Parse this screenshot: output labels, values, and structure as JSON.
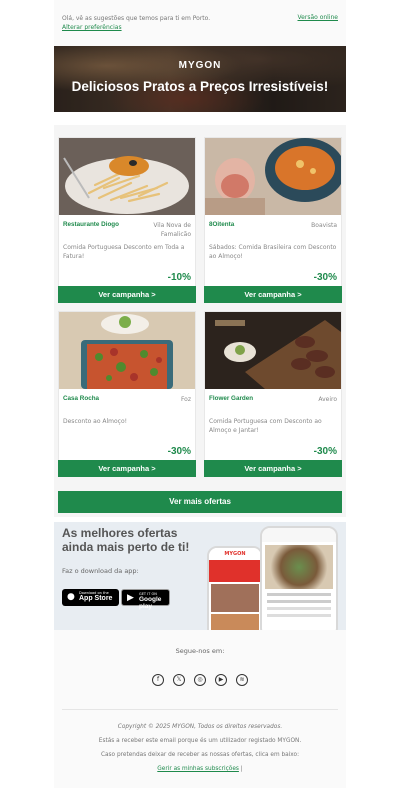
{
  "preheader": {
    "intro_text": "Olá, vê as sugestões que temos para ti em Porto.",
    "preferences_link": "Alterar preferências",
    "online_version_link": "Versão online"
  },
  "hero": {
    "logo": "MYGON",
    "headline": "Deliciosos Pratos a Preços Irresistíveis!"
  },
  "cards": [
    {
      "name": "Restaurante Diogo",
      "location": "Vila Nova de Famalicão",
      "description": "Comida Portuguesa Desconto em Toda a Fatura!",
      "discount": "-10%",
      "button": "Ver campanha >"
    },
    {
      "name": "8Oitenta",
      "location": "Boavista",
      "description": "Sábados: Comida Brasileira com Desconto ao Almoço!",
      "discount": "-30%",
      "button": "Ver campanha >"
    },
    {
      "name": "Casa Rocha",
      "location": "Foz",
      "description": "Desconto ao Almoço!",
      "discount": "-30%",
      "button": "Ver campanha >"
    },
    {
      "name": "Flower Garden",
      "location": "Aveiro",
      "description": "Comida Portuguesa com Desconto ao Almoço e Jantar!",
      "discount": "-30%",
      "button": "Ver campanha >"
    }
  ],
  "more_button": "Ver mais ofertas",
  "app_section": {
    "headline": "As melhores ofertas ainda mais perto de ti!",
    "download_text": "Faz o download da app:",
    "appstore_small": "Download on the",
    "appstore_big": "App Store",
    "googleplay_small": "GET IT ON",
    "googleplay_big": "Google play"
  },
  "footer": {
    "follow_text": "Segue-nos em:",
    "socials": [
      "facebook-icon",
      "x-icon",
      "instagram-icon",
      "youtube-icon",
      "rss-icon"
    ],
    "copyright": "Copyright © 2025 MYGON, Todos os direitos reservados.",
    "reason": "Estás a receber este email porque és um utilizador registado MYGON.",
    "unsubscribe_prompt": "Caso pretendas deixar de receber as nossas ofertas, clica em baixo:",
    "manage_link": "Gerir as minhas subscrições",
    "separator": "|"
  },
  "colors": {
    "brand_green": "#1f8a4c"
  }
}
